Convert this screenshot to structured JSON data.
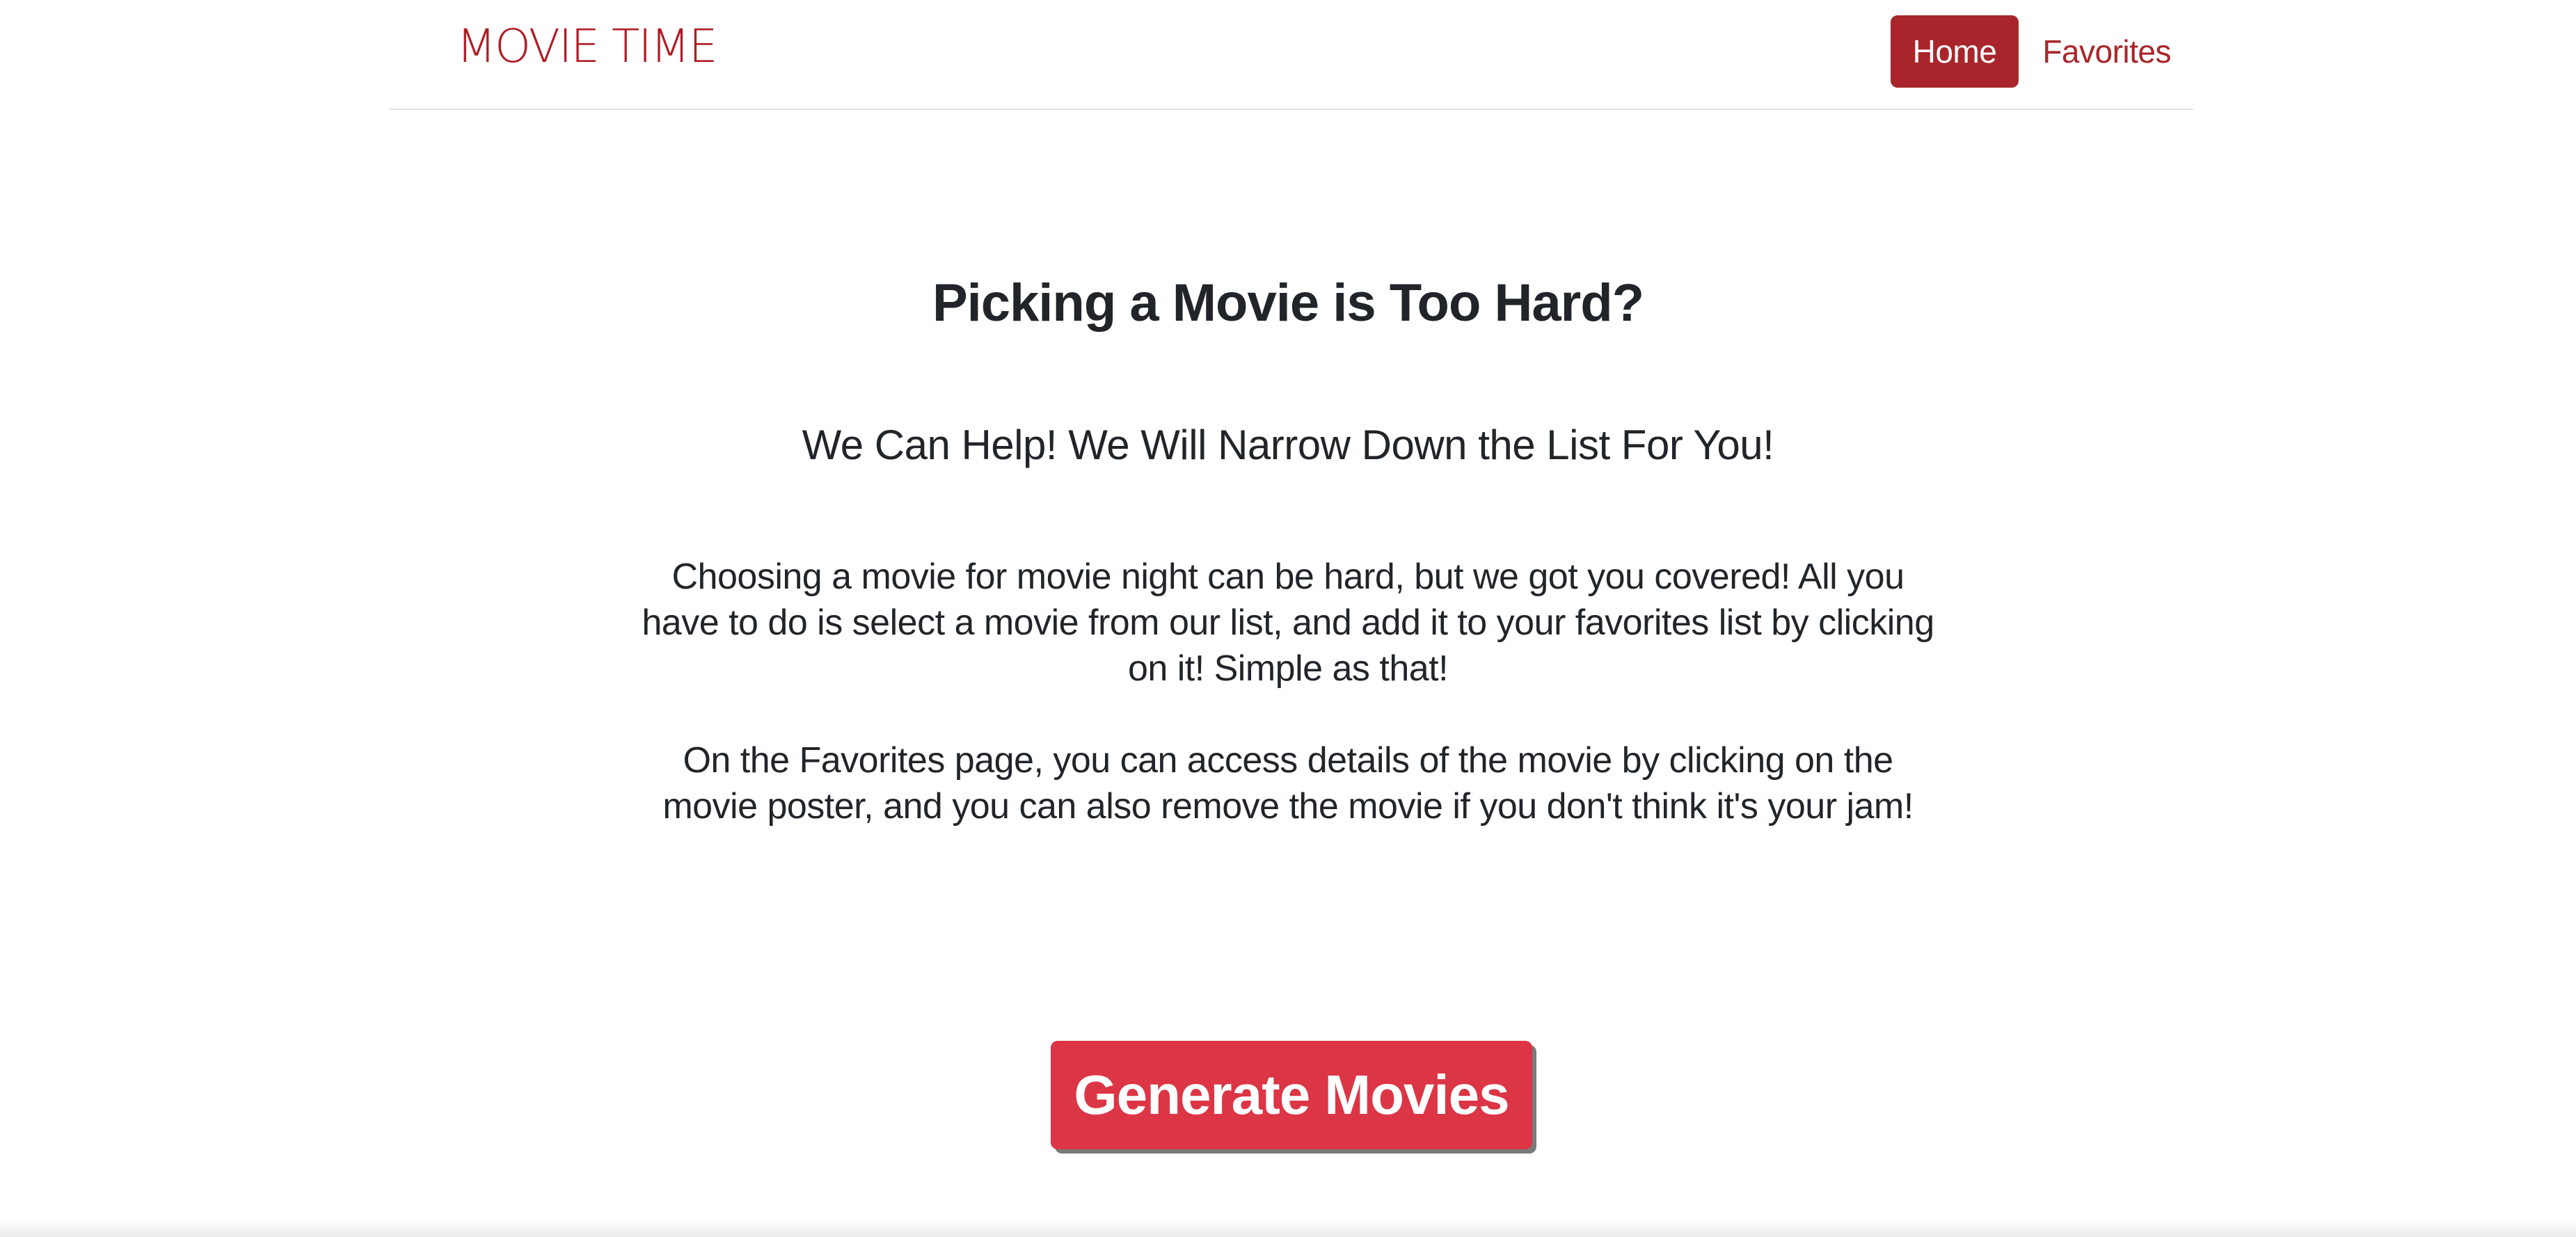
{
  "navbar": {
    "brand": "MOVIE TIME",
    "links": [
      {
        "label": "Home",
        "active": true
      },
      {
        "label": "Favorites",
        "active": false
      }
    ]
  },
  "hero": {
    "title": "Picking a Movie is Too Hard?",
    "subtitle": "We Can Help! We Will Narrow Down the List For You!",
    "paragraphs": [
      "Choosing a movie for movie night can be hard, but we got you covered! All you have to do is select a movie from our list, and add it to your favorites list by clicking on it! Simple as that!",
      "On the Favorites page, you can access details of the movie by clicking on the movie poster, and you can also remove the movie if you don't think it's your jam!"
    ]
  },
  "actions": {
    "generate_label": "Generate Movies"
  },
  "colors": {
    "brand": "#b01c24",
    "nav_active_bg": "#a8262b",
    "button_bg": "#dc3545",
    "text": "#212529"
  }
}
